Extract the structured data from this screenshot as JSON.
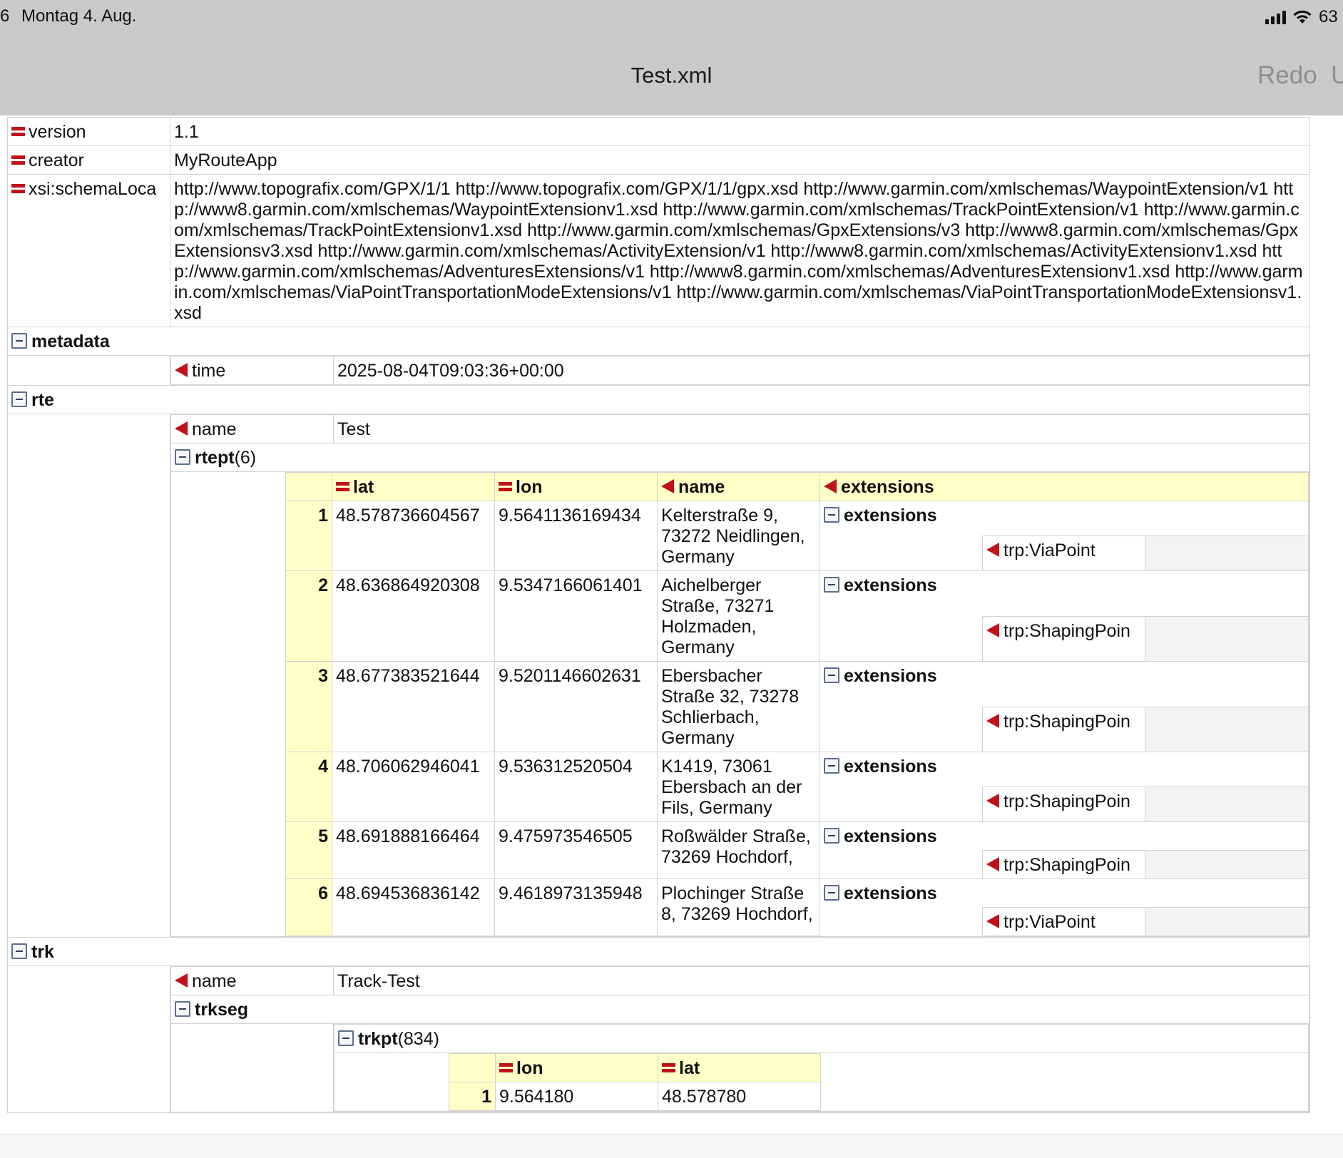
{
  "status_bar": {
    "time": "6",
    "date": "Montag 4. Aug.",
    "battery": "63"
  },
  "header": {
    "title": "Test.xml",
    "redo_label": "Redo"
  },
  "attributes": [
    {
      "name": "version",
      "value": "1.1"
    },
    {
      "name": "creator",
      "value": "MyRouteApp"
    },
    {
      "name": "xsi:schemaLoca",
      "value": "http://www.topografix.com/GPX/1/1 http://www.topografix.com/GPX/1/1/gpx.xsd http://www.garmin.com/xmlschemas/WaypointExtension/v1 http://www8.garmin.com/xmlschemas/WaypointExtensionv1.xsd http://www.garmin.com/xmlschemas/TrackPointExtension/v1 http://www.garmin.com/xmlschemas/TrackPointExtensionv1.xsd http://www.garmin.com/xmlschemas/GpxExtensions/v3 http://www8.garmin.com/xmlschemas/GpxExtensionsv3.xsd http://www.garmin.com/xmlschemas/ActivityExtension/v1 http://www8.garmin.com/xmlschemas/ActivityExtensionv1.xsd http://www.garmin.com/xmlschemas/AdventuresExtensions/v1 http://www8.garmin.com/xmlschemas/AdventuresExtensionv1.xsd http://www.garmin.com/xmlschemas/ViaPointTransportationModeExtensions/v1 http://www.garmin.com/xmlschemas/ViaPointTransportationModeExtensionsv1.xsd"
    }
  ],
  "metadata": {
    "label": "metadata",
    "time_label": "time",
    "time_value": "2025-08-04T09:03:36+00:00"
  },
  "rte": {
    "label": "rte",
    "name_label": "name",
    "name_value": "Test",
    "rtept_label": "rtept",
    "rtept_count": "(6)",
    "columns": {
      "lat": "lat",
      "lon": "lon",
      "name": "name",
      "extensions": "extensions"
    },
    "rows": [
      {
        "index": "1",
        "lat": "48.578736604567",
        "lon": "9.5641136169434",
        "name": "Kelterstraße 9, 73272 Neidlingen, Germany",
        "ext_label": "extensions",
        "ext_child": "trp:ViaPoint"
      },
      {
        "index": "2",
        "lat": "48.636864920308",
        "lon": "9.5347166061401",
        "name": "Aichelberger Straße, 73271 Holzmaden, Germany",
        "ext_label": "extensions",
        "ext_child": "trp:ShapingPoin"
      },
      {
        "index": "3",
        "lat": "48.677383521644",
        "lon": "9.5201146602631",
        "name": "Ebersbacher Straße 32, 73278 Schlierbach, Germany",
        "ext_label": "extensions",
        "ext_child": "trp:ShapingPoin"
      },
      {
        "index": "4",
        "lat": "48.706062946041",
        "lon": "9.536312520504",
        "name": "K1419, 73061 Ebersbach an der Fils, Germany",
        "ext_label": "extensions",
        "ext_child": "trp:ShapingPoin"
      },
      {
        "index": "5",
        "lat": "48.691888166464",
        "lon": "9.475973546505",
        "name": "Roßwälder Straße, 73269 Hochdorf,",
        "ext_label": "extensions",
        "ext_child": "trp:ShapingPoin"
      },
      {
        "index": "6",
        "lat": "48.694536836142",
        "lon": "9.4618973135948",
        "name": "Plochinger Straße 8, 73269 Hochdorf,",
        "ext_label": "extensions",
        "ext_child": "trp:ViaPoint"
      }
    ]
  },
  "trk": {
    "label": "trk",
    "name_label": "name",
    "name_value": "Track-Test",
    "trkseg_label": "trkseg",
    "trkpt_label": "trkpt",
    "trkpt_count": "(834)",
    "columns": {
      "lon": "lon",
      "lat": "lat"
    },
    "rows": [
      {
        "index": "1",
        "lon": "9.564180",
        "lat": "48.578780"
      }
    ]
  }
}
